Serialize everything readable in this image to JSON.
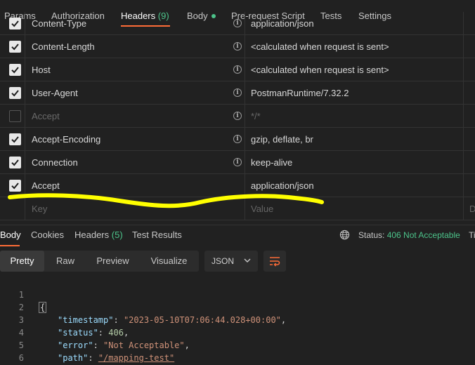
{
  "request_tabs": [
    {
      "label": "Params"
    },
    {
      "label": "Authorization"
    },
    {
      "label": "Headers",
      "count": "(9)"
    },
    {
      "label": "Body"
    },
    {
      "label": "Pre-request Script"
    },
    {
      "label": "Tests"
    },
    {
      "label": "Settings"
    }
  ],
  "headers": [
    {
      "checked": true,
      "key": "Content-Type",
      "value": "application/json"
    },
    {
      "checked": true,
      "key": "Content-Length",
      "value": "<calculated when request is sent>"
    },
    {
      "checked": true,
      "key": "Host",
      "value": "<calculated when request is sent>"
    },
    {
      "checked": true,
      "key": "User-Agent",
      "value": "PostmanRuntime/7.32.2"
    },
    {
      "checked": false,
      "key": "Accept",
      "value": "*/*"
    },
    {
      "checked": true,
      "key": "Accept-Encoding",
      "value": "gzip, deflate, br"
    },
    {
      "checked": true,
      "key": "Connection",
      "value": "keep-alive"
    },
    {
      "checked": true,
      "key": "Accept",
      "value": "application/json"
    }
  ],
  "new_row": {
    "key_placeholder": "Key",
    "value_placeholder": "Value",
    "desc_placeholder": "D"
  },
  "response_tabs": [
    {
      "label": "Body"
    },
    {
      "label": "Cookies"
    },
    {
      "label": "Headers",
      "count": "(5)"
    },
    {
      "label": "Test Results"
    }
  ],
  "status": {
    "label": "Status:",
    "value": "406 Not Acceptable",
    "time_label": "Ti"
  },
  "format_buttons": [
    "Pretty",
    "Raw",
    "Preview",
    "Visualize"
  ],
  "format_select": "JSON",
  "code_lines": [
    {
      "num": "1",
      "text": "{"
    },
    {
      "num": "2",
      "key": "\"timestamp\"",
      "value": "\"2023-05-10T07:06:44.028+00:00\"",
      "trail": ","
    },
    {
      "num": "3",
      "key": "\"status\"",
      "value": "406",
      "trail": ","
    },
    {
      "num": "4",
      "key": "\"error\"",
      "value": "\"Not Acceptable\"",
      "trail": ","
    },
    {
      "num": "5",
      "key": "\"path\"",
      "value": "\"/mapping-test\"",
      "trail": ""
    },
    {
      "num": "6",
      "text": "}"
    }
  ],
  "colors": {
    "accent": "#ff6c37",
    "success": "#4cc38a",
    "highlight": "#ffff00",
    "background": "#212121"
  }
}
